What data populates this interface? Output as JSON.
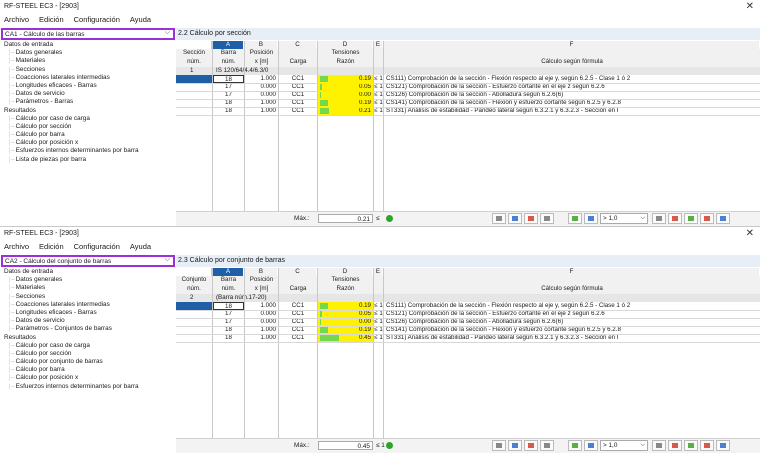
{
  "windows": [
    {
      "title": "RF-STEEL EC3 - [2903]",
      "menu": [
        "Archivo",
        "Edición",
        "Configuración",
        "Ayuda"
      ],
      "case_selector": "CA1 - Cálculo de las barras",
      "panel_title": "2.2 Cálculo por sección",
      "tree": [
        {
          "label": "Datos de entrada",
          "level": 0
        },
        {
          "label": "Datos generales",
          "level": 1
        },
        {
          "label": "Materiales",
          "level": 1
        },
        {
          "label": "Secciones",
          "level": 1
        },
        {
          "label": "Coacciones laterales intermedias",
          "level": 1
        },
        {
          "label": "Longitudes eficaces - Barras",
          "level": 1
        },
        {
          "label": "Datos de servicio",
          "level": 1
        },
        {
          "label": "Parámetros - Barras",
          "level": 1
        },
        {
          "label": "Resultados",
          "level": 0
        },
        {
          "label": "Cálculo por caso de carga",
          "level": 1
        },
        {
          "label": "Cálculo por sección",
          "level": 1
        },
        {
          "label": "Cálculo por barra",
          "level": 1
        },
        {
          "label": "Cálculo por posición x",
          "level": 1
        },
        {
          "label": "Esfuerzos internos determinantes por barra",
          "level": 1
        },
        {
          "label": "Lista de piezas por barra",
          "level": 1
        }
      ],
      "columns": {
        "letters": [
          "A",
          "B",
          "C",
          "D",
          "E",
          "F"
        ],
        "first_col_h1": "Sección",
        "first_col_h2": "núm.",
        "a_h1": "Barra",
        "a_h2": "núm.",
        "b_h1": "Posición",
        "b_h2": "x [m]",
        "c_h2": "Carga",
        "d_h1": "Tensiones",
        "d_h2": "Razón",
        "f_h2": "Cálculo según fórmula"
      },
      "group": {
        "num": "1",
        "desc": "IS 120/64/4.4/6.3/0"
      },
      "rows": [
        {
          "bar": "18",
          "pos": "1.000",
          "lc": "CC1",
          "ratio": "0.19",
          "ratio_value": 0.19,
          "le": "≤ 1",
          "formula": "CS111) Comprobación de la sección - Flexión respecto al eje y, según 6.2.5 - Clase 1 ó 2"
        },
        {
          "bar": "17",
          "pos": "0.000",
          "lc": "CC1",
          "ratio": "0.05",
          "ratio_value": 0.05,
          "le": "≤ 1",
          "formula": "CS121) Comprobación de la sección - Esfuerzo cortante en el eje z según 6.2.6"
        },
        {
          "bar": "17",
          "pos": "0.000",
          "lc": "CC1",
          "ratio": "0.00",
          "ratio_value": 0.0,
          "le": "≤ 1",
          "formula": "CS126) Comprobación de la sección - Abolladura según 6.2.6(6)"
        },
        {
          "bar": "18",
          "pos": "1.000",
          "lc": "CC1",
          "ratio": "0.19",
          "ratio_value": 0.19,
          "le": "≤ 1",
          "formula": "CS141) Comprobación de la sección - Flexión y esfuerzo cortante según 6.2.5 y 6.2.8"
        },
        {
          "bar": "18",
          "pos": "1.000",
          "lc": "CC1",
          "ratio": "0.21",
          "ratio_value": 0.21,
          "le": "≤ 1",
          "formula": "ST331) Análisis de estabilidad - Pandeo lateral según 6.3.2.1 y 6.3.2.3 - Sección en I"
        }
      ],
      "footer": {
        "max_label": "Máx.:",
        "max_value": "0.21",
        "le": "≤",
        "filter": "> 1,0"
      }
    },
    {
      "title": "RF-STEEL EC3 - [2903]",
      "menu": [
        "Archivo",
        "Edición",
        "Configuración",
        "Ayuda"
      ],
      "case_selector": "CA2 - Cálculo del conjunto de barras",
      "panel_title": "2.3 Cálculo por conjunto de barras",
      "tree": [
        {
          "label": "Datos de entrada",
          "level": 0
        },
        {
          "label": "Datos generales",
          "level": 1
        },
        {
          "label": "Materiales",
          "level": 1
        },
        {
          "label": "Secciones",
          "level": 1
        },
        {
          "label": "Coacciones laterales intermedias",
          "level": 1
        },
        {
          "label": "Longitudes eficaces - Barras",
          "level": 1
        },
        {
          "label": "Datos de servicio",
          "level": 1
        },
        {
          "label": "Parámetros - Conjuntos de barras",
          "level": 1
        },
        {
          "label": "Resultados",
          "level": 0
        },
        {
          "label": "Cálculo por caso de carga",
          "level": 1
        },
        {
          "label": "Cálculo por sección",
          "level": 1
        },
        {
          "label": "Cálculo por conjunto de barras",
          "level": 1
        },
        {
          "label": "Cálculo por barra",
          "level": 1
        },
        {
          "label": "Cálculo por posición x",
          "level": 1
        },
        {
          "label": "Esfuerzos internos determinantes por barra",
          "level": 1
        }
      ],
      "columns": {
        "letters": [
          "A",
          "B",
          "C",
          "D",
          "E",
          "F"
        ],
        "first_col_h1": "Conjunto",
        "first_col_h2": "núm.",
        "a_h1": "Barra",
        "a_h2": "núm.",
        "b_h1": "Posición",
        "b_h2": "x [m]",
        "c_h2": "Carga",
        "d_h1": "Tensiones",
        "d_h2": "Razón",
        "f_h2": "Cálculo según fórmula"
      },
      "group": {
        "num": "2",
        "desc": "(Barra núm.17-20)"
      },
      "rows": [
        {
          "bar": "18",
          "pos": "1.000",
          "lc": "CC1",
          "ratio": "0.19",
          "ratio_value": 0.19,
          "le": "≤ 1",
          "formula": "CS111) Comprobación de la sección - Flexión respecto al eje y, según 6.2.5 - Clase 1 ó 2"
        },
        {
          "bar": "17",
          "pos": "0.000",
          "lc": "CC1",
          "ratio": "0.05",
          "ratio_value": 0.05,
          "le": "≤ 1",
          "formula": "CS121) Comprobación de la sección - Esfuerzo cortante en el eje z según 6.2.6"
        },
        {
          "bar": "17",
          "pos": "0.000",
          "lc": "CC1",
          "ratio": "0.00",
          "ratio_value": 0.0,
          "le": "≤ 1",
          "formula": "CS126) Comprobación de la sección - Abolladura según 6.2.6(6)"
        },
        {
          "bar": "18",
          "pos": "1.000",
          "lc": "CC1",
          "ratio": "0.19",
          "ratio_value": 0.19,
          "le": "≤ 1",
          "formula": "CS141) Comprobación de la sección - Flexión y esfuerzo cortante según 6.2.5 y 6.2.8"
        },
        {
          "bar": "18",
          "pos": "1.000",
          "lc": "CC1",
          "ratio": "0.45",
          "ratio_value": 0.45,
          "le": "≤ 1",
          "formula": "ST331) Análisis de estabilidad - Pandeo lateral según 6.3.2.1 y 6.3.2.3 - Sección en I"
        }
      ],
      "footer": {
        "max_label": "Máx.:",
        "max_value": "0.45",
        "le": "≤ 1",
        "filter": "> 1,0"
      }
    }
  ],
  "colors": {
    "accent": "#9b30d9",
    "header": "#1f5fa8",
    "ratio_bg": "#fff200",
    "ratio_bar": "#74d84a"
  }
}
